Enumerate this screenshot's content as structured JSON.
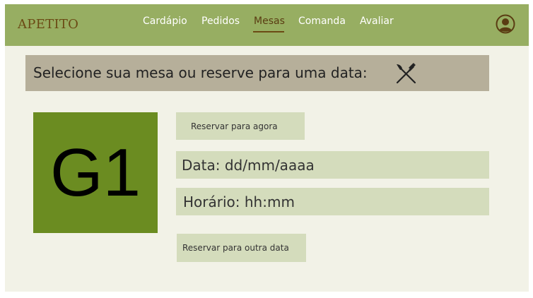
{
  "brand": "APETITO",
  "nav": {
    "items": [
      {
        "label": "Cardápio"
      },
      {
        "label": "Pedidos"
      },
      {
        "label": "Mesas"
      },
      {
        "label": "Comanda"
      },
      {
        "label": "Avaliar"
      }
    ],
    "active": "Mesas"
  },
  "banner": {
    "text": "Selecione sua mesa ou reserve para uma data:",
    "icon": "fork-knife-icon"
  },
  "table": {
    "label": "G1"
  },
  "reservation": {
    "now_button": "Reservar para agora",
    "date_field": "Data: dd/mm/aaaa",
    "time_field": "Horário: hh:mm",
    "other_date_button": "Reservar para outra data"
  },
  "colors": {
    "navbar": "#97ae62",
    "brand": "#6b4a14",
    "banner": "#b6af9a",
    "table_tile": "#6b8c21",
    "field_bg": "#d4dcbc",
    "page_bg": "#f2f2e7"
  }
}
